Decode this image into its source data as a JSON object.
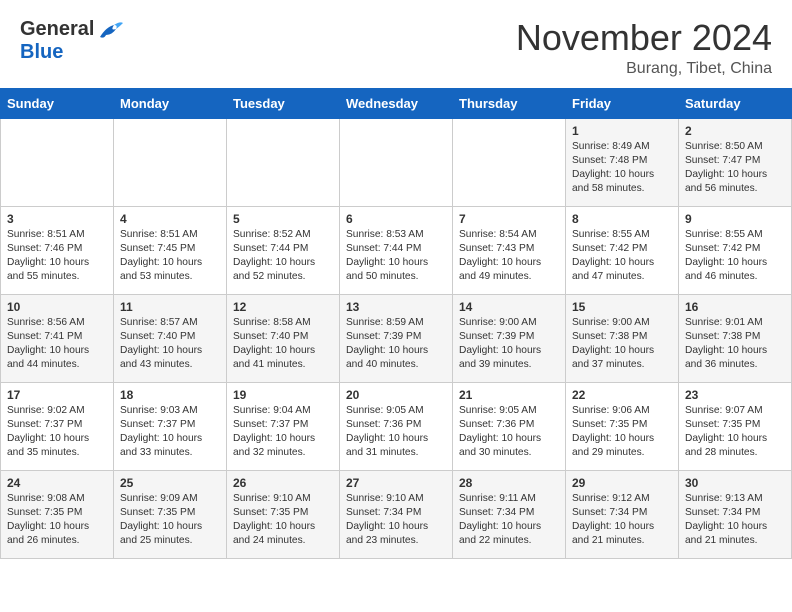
{
  "logo": {
    "general": "General",
    "blue": "Blue"
  },
  "title": "November 2024",
  "subtitle": "Burang, Tibet, China",
  "weekdays": [
    "Sunday",
    "Monday",
    "Tuesday",
    "Wednesday",
    "Thursday",
    "Friday",
    "Saturday"
  ],
  "weeks": [
    [
      {
        "day": "",
        "info": ""
      },
      {
        "day": "",
        "info": ""
      },
      {
        "day": "",
        "info": ""
      },
      {
        "day": "",
        "info": ""
      },
      {
        "day": "",
        "info": ""
      },
      {
        "day": "1",
        "info": "Sunrise: 8:49 AM\nSunset: 7:48 PM\nDaylight: 10 hours\nand 58 minutes."
      },
      {
        "day": "2",
        "info": "Sunrise: 8:50 AM\nSunset: 7:47 PM\nDaylight: 10 hours\nand 56 minutes."
      }
    ],
    [
      {
        "day": "3",
        "info": "Sunrise: 8:51 AM\nSunset: 7:46 PM\nDaylight: 10 hours\nand 55 minutes."
      },
      {
        "day": "4",
        "info": "Sunrise: 8:51 AM\nSunset: 7:45 PM\nDaylight: 10 hours\nand 53 minutes."
      },
      {
        "day": "5",
        "info": "Sunrise: 8:52 AM\nSunset: 7:44 PM\nDaylight: 10 hours\nand 52 minutes."
      },
      {
        "day": "6",
        "info": "Sunrise: 8:53 AM\nSunset: 7:44 PM\nDaylight: 10 hours\nand 50 minutes."
      },
      {
        "day": "7",
        "info": "Sunrise: 8:54 AM\nSunset: 7:43 PM\nDaylight: 10 hours\nand 49 minutes."
      },
      {
        "day": "8",
        "info": "Sunrise: 8:55 AM\nSunset: 7:42 PM\nDaylight: 10 hours\nand 47 minutes."
      },
      {
        "day": "9",
        "info": "Sunrise: 8:55 AM\nSunset: 7:42 PM\nDaylight: 10 hours\nand 46 minutes."
      }
    ],
    [
      {
        "day": "10",
        "info": "Sunrise: 8:56 AM\nSunset: 7:41 PM\nDaylight: 10 hours\nand 44 minutes."
      },
      {
        "day": "11",
        "info": "Sunrise: 8:57 AM\nSunset: 7:40 PM\nDaylight: 10 hours\nand 43 minutes."
      },
      {
        "day": "12",
        "info": "Sunrise: 8:58 AM\nSunset: 7:40 PM\nDaylight: 10 hours\nand 41 minutes."
      },
      {
        "day": "13",
        "info": "Sunrise: 8:59 AM\nSunset: 7:39 PM\nDaylight: 10 hours\nand 40 minutes."
      },
      {
        "day": "14",
        "info": "Sunrise: 9:00 AM\nSunset: 7:39 PM\nDaylight: 10 hours\nand 39 minutes."
      },
      {
        "day": "15",
        "info": "Sunrise: 9:00 AM\nSunset: 7:38 PM\nDaylight: 10 hours\nand 37 minutes."
      },
      {
        "day": "16",
        "info": "Sunrise: 9:01 AM\nSunset: 7:38 PM\nDaylight: 10 hours\nand 36 minutes."
      }
    ],
    [
      {
        "day": "17",
        "info": "Sunrise: 9:02 AM\nSunset: 7:37 PM\nDaylight: 10 hours\nand 35 minutes."
      },
      {
        "day": "18",
        "info": "Sunrise: 9:03 AM\nSunset: 7:37 PM\nDaylight: 10 hours\nand 33 minutes."
      },
      {
        "day": "19",
        "info": "Sunrise: 9:04 AM\nSunset: 7:37 PM\nDaylight: 10 hours\nand 32 minutes."
      },
      {
        "day": "20",
        "info": "Sunrise: 9:05 AM\nSunset: 7:36 PM\nDaylight: 10 hours\nand 31 minutes."
      },
      {
        "day": "21",
        "info": "Sunrise: 9:05 AM\nSunset: 7:36 PM\nDaylight: 10 hours\nand 30 minutes."
      },
      {
        "day": "22",
        "info": "Sunrise: 9:06 AM\nSunset: 7:35 PM\nDaylight: 10 hours\nand 29 minutes."
      },
      {
        "day": "23",
        "info": "Sunrise: 9:07 AM\nSunset: 7:35 PM\nDaylight: 10 hours\nand 28 minutes."
      }
    ],
    [
      {
        "day": "24",
        "info": "Sunrise: 9:08 AM\nSunset: 7:35 PM\nDaylight: 10 hours\nand 26 minutes."
      },
      {
        "day": "25",
        "info": "Sunrise: 9:09 AM\nSunset: 7:35 PM\nDaylight: 10 hours\nand 25 minutes."
      },
      {
        "day": "26",
        "info": "Sunrise: 9:10 AM\nSunset: 7:35 PM\nDaylight: 10 hours\nand 24 minutes."
      },
      {
        "day": "27",
        "info": "Sunrise: 9:10 AM\nSunset: 7:34 PM\nDaylight: 10 hours\nand 23 minutes."
      },
      {
        "day": "28",
        "info": "Sunrise: 9:11 AM\nSunset: 7:34 PM\nDaylight: 10 hours\nand 22 minutes."
      },
      {
        "day": "29",
        "info": "Sunrise: 9:12 AM\nSunset: 7:34 PM\nDaylight: 10 hours\nand 21 minutes."
      },
      {
        "day": "30",
        "info": "Sunrise: 9:13 AM\nSunset: 7:34 PM\nDaylight: 10 hours\nand 21 minutes."
      }
    ]
  ]
}
